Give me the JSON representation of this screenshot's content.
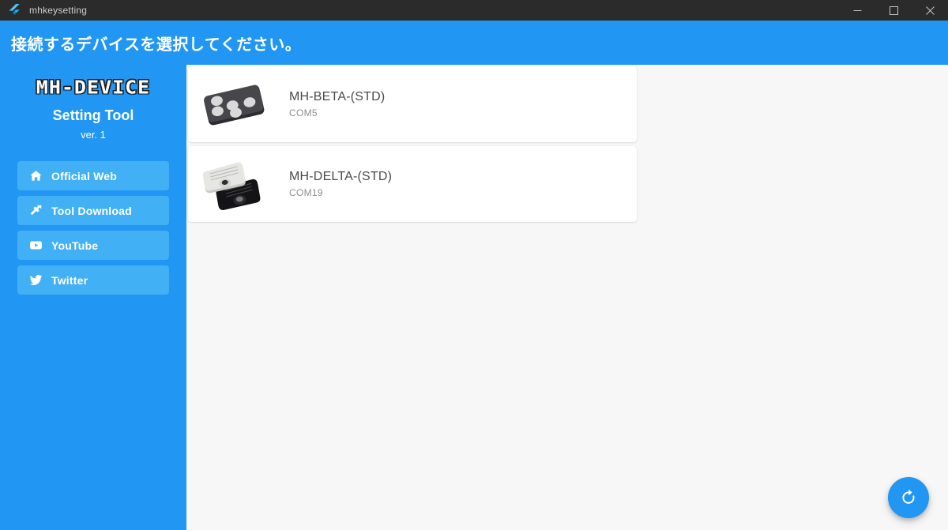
{
  "window": {
    "title": "mhkeysetting",
    "app_icon": "flutter-logo-icon",
    "controls": {
      "minimize_label": "─",
      "maximize_label": "□",
      "close_label": "✕"
    }
  },
  "header": {
    "title": "接続するデバイスを選択してください。",
    "background_color": "#2196f3"
  },
  "sidebar": {
    "background_color": "#2196f3",
    "brand": {
      "logo_text": "MH-DEVICE",
      "subtitle": "Setting Tool",
      "version": "ver. 1"
    },
    "items": [
      {
        "label": "Official Web",
        "icon": "home-icon"
      },
      {
        "label": "Tool Download",
        "icon": "hammer-icon"
      },
      {
        "label": "YouTube",
        "icon": "youtube-icon"
      },
      {
        "label": "Twitter",
        "icon": "twitter-bird-icon"
      }
    ]
  },
  "main": {
    "background_color": "#f7f7f7",
    "devices": [
      {
        "name": "MH-BETA-(STD)",
        "port": "COM5",
        "thumb": "mh-beta-device-image",
        "thumb_body_color": "#3e3e42",
        "thumb_button_color": "#d8d8d8"
      },
      {
        "name": "MH-DELTA-(STD)",
        "port": "COM19",
        "thumb": "mh-delta-device-image",
        "thumb_body_color": "#e3e3e0",
        "thumb_body_color_2": "#17171a"
      }
    ],
    "refresh_button": {
      "icon": "refresh-icon",
      "color": "#2196f3"
    }
  }
}
